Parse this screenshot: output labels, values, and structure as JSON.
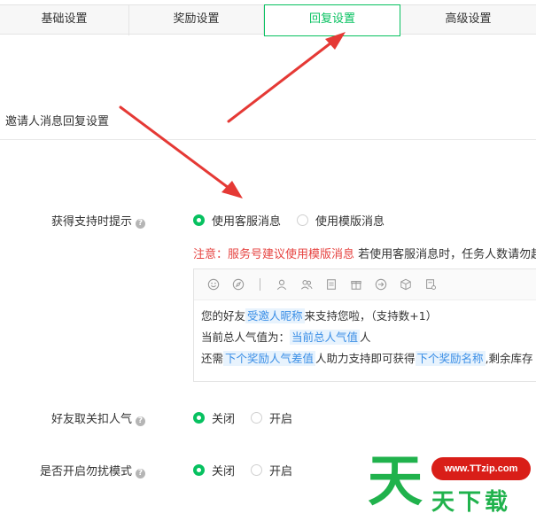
{
  "tabs": [
    {
      "label": "基础设置",
      "active": false
    },
    {
      "label": "奖励设置",
      "active": false
    },
    {
      "label": "回复设置",
      "active": true
    },
    {
      "label": "高级设置",
      "active": false
    }
  ],
  "section": {
    "title": "邀请人消息回复设置"
  },
  "support_tip": {
    "label": "获得支持时提示",
    "help_icon": "question-icon",
    "options": [
      "使用客服消息",
      "使用模版消息"
    ],
    "selected": "使用客服消息"
  },
  "notice": {
    "red": "注意：服务号建议使用模版消息",
    "black": " 若使用客服消息时，任务人数请勿超过"
  },
  "editor": {
    "toolbar_icons": [
      "emoji-icon",
      "compass-icon",
      "user-icon",
      "users-icon",
      "document-icon",
      "gift-icon",
      "arrow-right-circle-icon",
      "cube-icon",
      "settings-doc-icon"
    ],
    "line1": {
      "a": "您的好友",
      "tag": "受邀人昵称",
      "b": "来支持您啦，（支持数+1）"
    },
    "line2": {
      "a": "当前总人气值为：",
      "tag": "当前总人气值",
      "b": "人"
    },
    "line3": {
      "a": "还需",
      "tag1": "下个奖励人气差值",
      "b": "人助力支持即可获得",
      "tag2": "下个奖励名称",
      "c": ",剩余库存"
    }
  },
  "unfollow": {
    "label": "好友取关扣人气",
    "options": [
      "关闭",
      "开启"
    ],
    "selected": "关闭"
  },
  "dnd": {
    "label": "是否开启勿扰模式",
    "options": [
      "关闭",
      "开启"
    ],
    "selected": "关闭"
  },
  "watermark": {
    "badge": "www.TTzip.com",
    "big_char": "天",
    "text": "天下载"
  },
  "colors": {
    "accent": "#07c160",
    "warning": "#e64340",
    "tag": "#3a8ee6",
    "arrow": "#e53935",
    "watermark_green": "#20b24c",
    "watermark_red": "#d91e18"
  }
}
